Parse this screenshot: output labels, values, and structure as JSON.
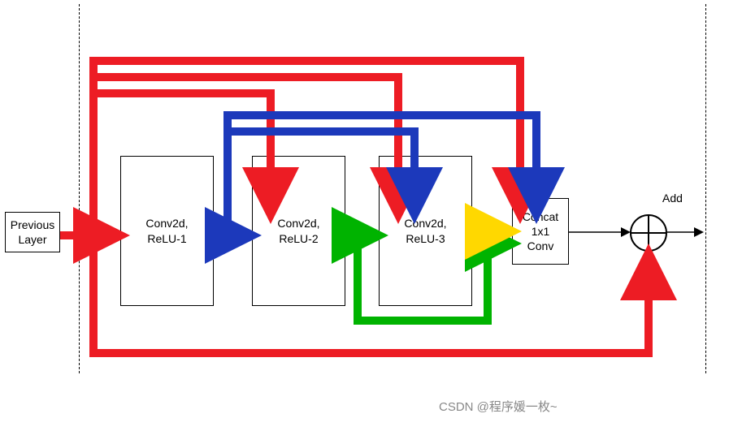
{
  "blocks": {
    "prev": "Previous\nLayer",
    "conv1": "Conv2d,\nReLU-1",
    "conv2": "Conv2d,\nReLU-2",
    "conv3": "Conv2d,\nReLU-3",
    "concat": "Concat\n1x1\nConv",
    "add": "Add"
  },
  "watermark": "CSDN @程序媛一枚~",
  "colors": {
    "red": "#ED1C24",
    "blue": "#1C39BB",
    "green": "#00B300",
    "yellow": "#FFD800",
    "black": "#000000"
  },
  "chart_data": {
    "type": "network-diagram",
    "nodes": [
      {
        "id": "prev",
        "label": "Previous Layer"
      },
      {
        "id": "conv1",
        "label": "Conv2d, ReLU-1"
      },
      {
        "id": "conv2",
        "label": "Conv2d, ReLU-2"
      },
      {
        "id": "conv3",
        "label": "Conv2d, ReLU-3"
      },
      {
        "id": "concat",
        "label": "Concat 1x1 Conv"
      },
      {
        "id": "add",
        "label": "Add",
        "op": "elementwise-sum"
      }
    ],
    "edges": [
      {
        "from": "prev",
        "to": "conv1",
        "color": "red"
      },
      {
        "from": "prev",
        "to": "conv2",
        "color": "red",
        "note": "skip"
      },
      {
        "from": "prev",
        "to": "conv3",
        "color": "red",
        "note": "skip"
      },
      {
        "from": "prev",
        "to": "concat",
        "color": "red",
        "note": "skip"
      },
      {
        "from": "prev",
        "to": "add",
        "color": "red",
        "note": "residual"
      },
      {
        "from": "conv1",
        "to": "conv2",
        "color": "blue"
      },
      {
        "from": "conv1",
        "to": "conv3",
        "color": "blue",
        "note": "skip"
      },
      {
        "from": "conv1",
        "to": "concat",
        "color": "blue",
        "note": "skip"
      },
      {
        "from": "conv2",
        "to": "conv3",
        "color": "green"
      },
      {
        "from": "conv2",
        "to": "concat",
        "color": "green",
        "note": "skip"
      },
      {
        "from": "conv3",
        "to": "concat",
        "color": "yellow"
      },
      {
        "from": "concat",
        "to": "add",
        "color": "black"
      }
    ]
  }
}
